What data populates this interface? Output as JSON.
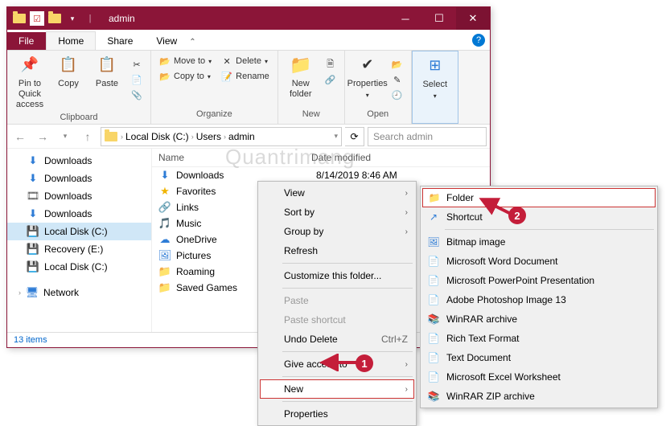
{
  "window": {
    "title": "admin",
    "tabs": {
      "file": "File",
      "home": "Home",
      "share": "Share",
      "view": "View"
    }
  },
  "ribbon": {
    "clipboard": {
      "pin": "Pin to Quick access",
      "copy": "Copy",
      "paste": "Paste",
      "label": "Clipboard"
    },
    "organize": {
      "moveto": "Move to",
      "copyto": "Copy to",
      "delete": "Delete",
      "rename": "Rename",
      "label": "Organize"
    },
    "new": {
      "newfolder": "New folder",
      "label": "New"
    },
    "open": {
      "properties": "Properties",
      "label": "Open"
    },
    "select": {
      "select": "Select",
      "label": "Select"
    }
  },
  "address": {
    "segs": [
      "Local Disk (C:)",
      "Users",
      "admin"
    ],
    "search_placeholder": "Search admin"
  },
  "nav": {
    "items": [
      {
        "icon": "⬇",
        "label": "Downloads",
        "color": "#2e7cd6"
      },
      {
        "icon": "⬇",
        "label": "Downloads",
        "color": "#2e7cd6"
      },
      {
        "icon": "🎞",
        "label": "Downloads",
        "color": "#555"
      },
      {
        "icon": "⬇",
        "label": "Downloads",
        "color": "#2e7cd6"
      },
      {
        "icon": "💾",
        "label": "Local Disk (C:)",
        "color": "#555",
        "selected": true
      },
      {
        "icon": "💾",
        "label": "Recovery (E:)",
        "color": "#555"
      },
      {
        "icon": "💾",
        "label": "Local Disk (C:)",
        "color": "#555"
      }
    ],
    "network": "Network"
  },
  "content": {
    "headers": {
      "name": "Name",
      "date": "Date modified"
    },
    "rows": [
      {
        "icon": "⬇",
        "name": "Downloads",
        "date": "8/14/2019 8:46 AM",
        "color": "#2e7cd6"
      },
      {
        "icon": "★",
        "name": "Favorites",
        "date": "",
        "color": "#f0b400"
      },
      {
        "icon": "🔗",
        "name": "Links",
        "date": "",
        "color": "#2e7cd6"
      },
      {
        "icon": "🎵",
        "name": "Music",
        "date": "",
        "color": "#2e7cd6"
      },
      {
        "icon": "☁",
        "name": "OneDrive",
        "date": "",
        "color": "#2e7cd6"
      },
      {
        "icon": "🖼",
        "name": "Pictures",
        "date": "",
        "color": "#2e7cd6"
      },
      {
        "icon": "📁",
        "name": "Roaming",
        "date": "",
        "color": "#f8d568"
      },
      {
        "icon": "📁",
        "name": "Saved Games",
        "date": "",
        "color": "#f8d568"
      }
    ]
  },
  "status": "13 items",
  "ctx_main": [
    {
      "label": "View",
      "arrow": true
    },
    {
      "label": "Sort by",
      "arrow": true
    },
    {
      "label": "Group by",
      "arrow": true
    },
    {
      "label": "Refresh"
    },
    {
      "sep": true
    },
    {
      "label": "Customize this folder..."
    },
    {
      "sep": true
    },
    {
      "label": "Paste",
      "disabled": true
    },
    {
      "label": "Paste shortcut",
      "disabled": true
    },
    {
      "label": "Undo Delete",
      "shortcut": "Ctrl+Z"
    },
    {
      "sep": true
    },
    {
      "label": "Give access to",
      "arrow": true
    },
    {
      "sep": true
    },
    {
      "label": "New",
      "arrow": true,
      "hl": true
    },
    {
      "sep": true
    },
    {
      "label": "Properties"
    }
  ],
  "ctx_sub": [
    {
      "icon": "📁",
      "label": "Folder",
      "hl": true,
      "color": "#f8d568"
    },
    {
      "icon": "↗",
      "label": "Shortcut",
      "color": "#2e7cd6"
    },
    {
      "sep": true
    },
    {
      "icon": "🖼",
      "label": "Bitmap image",
      "color": "#2e7cd6"
    },
    {
      "icon": "📄",
      "label": "Microsoft Word Document",
      "color": "#2a5699"
    },
    {
      "icon": "📄",
      "label": "Microsoft PowerPoint Presentation",
      "color": "#d04424"
    },
    {
      "icon": "📄",
      "label": "Adobe Photoshop Image 13",
      "color": "#2a5699"
    },
    {
      "icon": "📚",
      "label": "WinRAR archive",
      "color": "#7a4a2a"
    },
    {
      "icon": "📄",
      "label": "Rich Text Format",
      "color": "#555"
    },
    {
      "icon": "📄",
      "label": "Text Document",
      "color": "#555"
    },
    {
      "icon": "📄",
      "label": "Microsoft Excel Worksheet",
      "color": "#1e7145"
    },
    {
      "icon": "📚",
      "label": "WinRAR ZIP archive",
      "color": "#7a4a2a"
    }
  ],
  "badges": {
    "b1": "1",
    "b2": "2"
  },
  "watermark": "Quantrimang"
}
